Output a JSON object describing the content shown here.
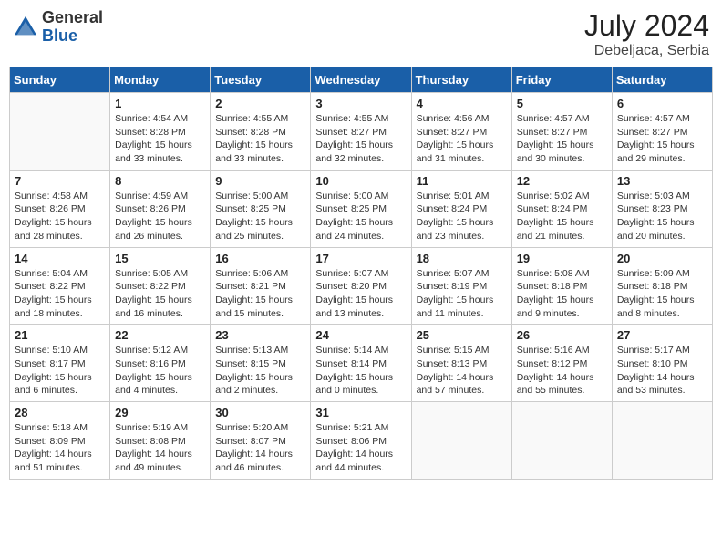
{
  "header": {
    "logo_general": "General",
    "logo_blue": "Blue",
    "month_year": "July 2024",
    "location": "Debeljaca, Serbia"
  },
  "weekdays": [
    "Sunday",
    "Monday",
    "Tuesday",
    "Wednesday",
    "Thursday",
    "Friday",
    "Saturday"
  ],
  "weeks": [
    [
      {
        "day": "",
        "info": ""
      },
      {
        "day": "1",
        "info": "Sunrise: 4:54 AM\nSunset: 8:28 PM\nDaylight: 15 hours\nand 33 minutes."
      },
      {
        "day": "2",
        "info": "Sunrise: 4:55 AM\nSunset: 8:28 PM\nDaylight: 15 hours\nand 33 minutes."
      },
      {
        "day": "3",
        "info": "Sunrise: 4:55 AM\nSunset: 8:27 PM\nDaylight: 15 hours\nand 32 minutes."
      },
      {
        "day": "4",
        "info": "Sunrise: 4:56 AM\nSunset: 8:27 PM\nDaylight: 15 hours\nand 31 minutes."
      },
      {
        "day": "5",
        "info": "Sunrise: 4:57 AM\nSunset: 8:27 PM\nDaylight: 15 hours\nand 30 minutes."
      },
      {
        "day": "6",
        "info": "Sunrise: 4:57 AM\nSunset: 8:27 PM\nDaylight: 15 hours\nand 29 minutes."
      }
    ],
    [
      {
        "day": "7",
        "info": "Sunrise: 4:58 AM\nSunset: 8:26 PM\nDaylight: 15 hours\nand 28 minutes."
      },
      {
        "day": "8",
        "info": "Sunrise: 4:59 AM\nSunset: 8:26 PM\nDaylight: 15 hours\nand 26 minutes."
      },
      {
        "day": "9",
        "info": "Sunrise: 5:00 AM\nSunset: 8:25 PM\nDaylight: 15 hours\nand 25 minutes."
      },
      {
        "day": "10",
        "info": "Sunrise: 5:00 AM\nSunset: 8:25 PM\nDaylight: 15 hours\nand 24 minutes."
      },
      {
        "day": "11",
        "info": "Sunrise: 5:01 AM\nSunset: 8:24 PM\nDaylight: 15 hours\nand 23 minutes."
      },
      {
        "day": "12",
        "info": "Sunrise: 5:02 AM\nSunset: 8:24 PM\nDaylight: 15 hours\nand 21 minutes."
      },
      {
        "day": "13",
        "info": "Sunrise: 5:03 AM\nSunset: 8:23 PM\nDaylight: 15 hours\nand 20 minutes."
      }
    ],
    [
      {
        "day": "14",
        "info": "Sunrise: 5:04 AM\nSunset: 8:22 PM\nDaylight: 15 hours\nand 18 minutes."
      },
      {
        "day": "15",
        "info": "Sunrise: 5:05 AM\nSunset: 8:22 PM\nDaylight: 15 hours\nand 16 minutes."
      },
      {
        "day": "16",
        "info": "Sunrise: 5:06 AM\nSunset: 8:21 PM\nDaylight: 15 hours\nand 15 minutes."
      },
      {
        "day": "17",
        "info": "Sunrise: 5:07 AM\nSunset: 8:20 PM\nDaylight: 15 hours\nand 13 minutes."
      },
      {
        "day": "18",
        "info": "Sunrise: 5:07 AM\nSunset: 8:19 PM\nDaylight: 15 hours\nand 11 minutes."
      },
      {
        "day": "19",
        "info": "Sunrise: 5:08 AM\nSunset: 8:18 PM\nDaylight: 15 hours\nand 9 minutes."
      },
      {
        "day": "20",
        "info": "Sunrise: 5:09 AM\nSunset: 8:18 PM\nDaylight: 15 hours\nand 8 minutes."
      }
    ],
    [
      {
        "day": "21",
        "info": "Sunrise: 5:10 AM\nSunset: 8:17 PM\nDaylight: 15 hours\nand 6 minutes."
      },
      {
        "day": "22",
        "info": "Sunrise: 5:12 AM\nSunset: 8:16 PM\nDaylight: 15 hours\nand 4 minutes."
      },
      {
        "day": "23",
        "info": "Sunrise: 5:13 AM\nSunset: 8:15 PM\nDaylight: 15 hours\nand 2 minutes."
      },
      {
        "day": "24",
        "info": "Sunrise: 5:14 AM\nSunset: 8:14 PM\nDaylight: 15 hours\nand 0 minutes."
      },
      {
        "day": "25",
        "info": "Sunrise: 5:15 AM\nSunset: 8:13 PM\nDaylight: 14 hours\nand 57 minutes."
      },
      {
        "day": "26",
        "info": "Sunrise: 5:16 AM\nSunset: 8:12 PM\nDaylight: 14 hours\nand 55 minutes."
      },
      {
        "day": "27",
        "info": "Sunrise: 5:17 AM\nSunset: 8:10 PM\nDaylight: 14 hours\nand 53 minutes."
      }
    ],
    [
      {
        "day": "28",
        "info": "Sunrise: 5:18 AM\nSunset: 8:09 PM\nDaylight: 14 hours\nand 51 minutes."
      },
      {
        "day": "29",
        "info": "Sunrise: 5:19 AM\nSunset: 8:08 PM\nDaylight: 14 hours\nand 49 minutes."
      },
      {
        "day": "30",
        "info": "Sunrise: 5:20 AM\nSunset: 8:07 PM\nDaylight: 14 hours\nand 46 minutes."
      },
      {
        "day": "31",
        "info": "Sunrise: 5:21 AM\nSunset: 8:06 PM\nDaylight: 14 hours\nand 44 minutes."
      },
      {
        "day": "",
        "info": ""
      },
      {
        "day": "",
        "info": ""
      },
      {
        "day": "",
        "info": ""
      }
    ]
  ]
}
